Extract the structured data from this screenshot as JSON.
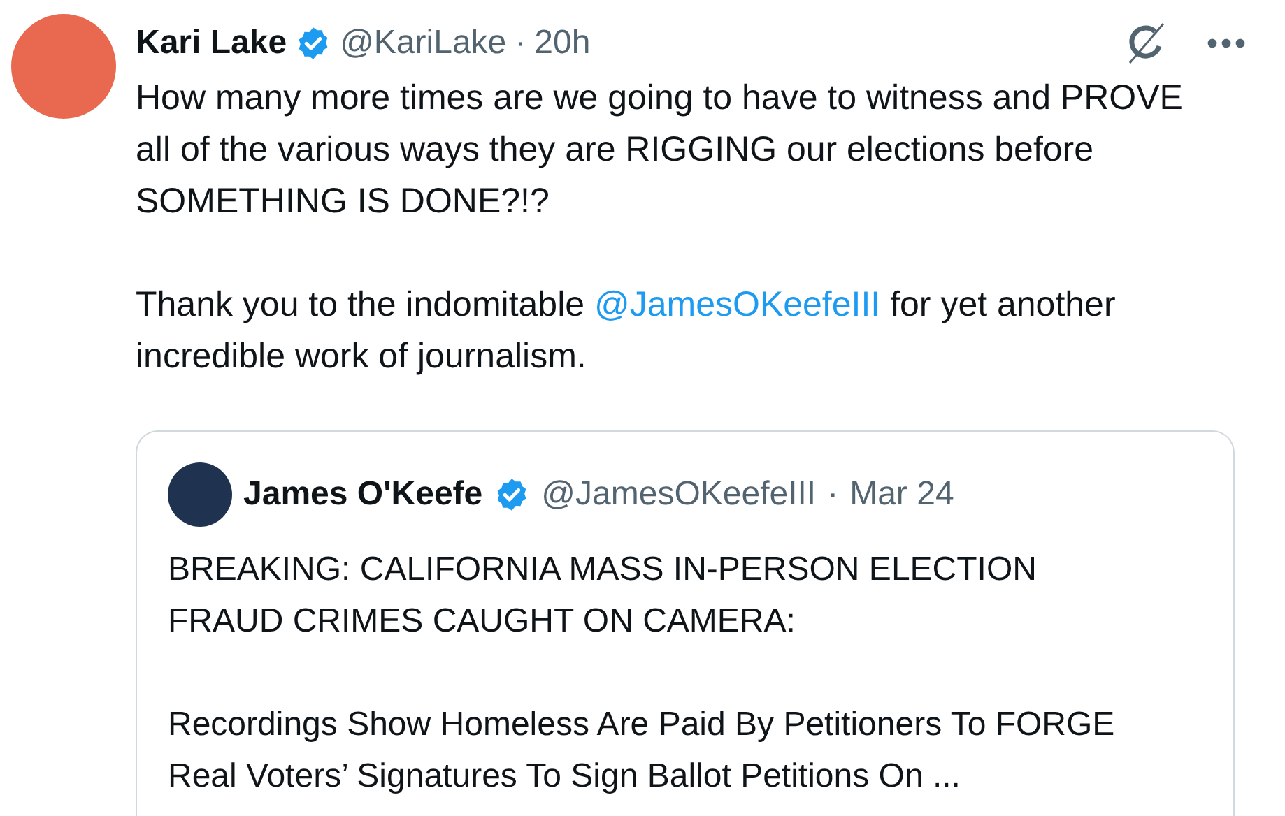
{
  "tweet": {
    "author": {
      "name": "Kari Lake",
      "verified": true,
      "handle": "@KariLake",
      "separator": "·",
      "time": "20h"
    },
    "paragraphs": [
      [
        {
          "kind": "text",
          "text": "How many more times are we going to have to witness and PROVE all of the various ways they are RIGGING our elections before SOMETHING IS DONE?!?"
        }
      ],
      [
        {
          "kind": "text",
          "text": "Thank you to the indomitable "
        },
        {
          "kind": "mention",
          "text": "@JamesOKeefeIII"
        },
        {
          "kind": "text",
          "text": " for yet another incredible work of journalism."
        }
      ]
    ],
    "quote": {
      "author": {
        "name": "James O'Keefe",
        "verified": true,
        "handle": "@JamesOKeefeIII",
        "separator": "·",
        "time": "Mar 24"
      },
      "paragraphs": [
        "BREAKING: CALIFORNIA MASS IN-PERSON ELECTION FRAUD CRIMES CAUGHT ON CAMERA:",
        "Recordings Show Homeless Are Paid By Petitioners To FORGE Real Voters’ Signatures To Sign Ballot Petitions On ..."
      ]
    }
  }
}
